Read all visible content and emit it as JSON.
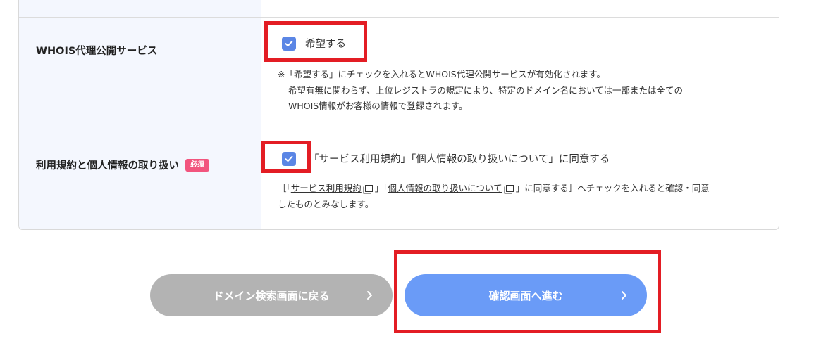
{
  "whois": {
    "label": "WHOIS代理公開サービス",
    "checkbox_label": "希望する",
    "checked": true,
    "note_line1": "※「希望する」にチェックを入れるとWHOIS代理公開サービスが有効化されます。",
    "note_line2": "希望有無に関わらず、上位レジストラの規定により、特定のドメイン名においては一部または全ての",
    "note_line3": "WHOIS情報がお客様の情報で登録されます。"
  },
  "terms": {
    "label": "利用規約と個人情報の取り扱い",
    "required_badge": "必須",
    "checkbox_label": "「サービス利用規約」「個人情報の取り扱いについて」に同意する",
    "checked": true,
    "note_prefix": "［「",
    "link1": "サービス利用規約",
    "note_mid": "」「",
    "link2": "個人情報の取り扱いについて",
    "note_suffix": "」に同意する］へチェックを入れると確認・同意",
    "note_line2": "したものとみなします。"
  },
  "buttons": {
    "back_label": "ドメイン検索画面に戻る",
    "next_label": "確認画面へ進む"
  },
  "icons": {
    "checkbox": "check-icon",
    "external_link": "external-link-icon",
    "chevron": "chevron-right-icon"
  },
  "colors": {
    "checkbox": "#5b86e5",
    "required_badge": "#f2557e",
    "next_button": "#6a9bf7",
    "back_button": "#b3b3b3",
    "highlight": "#e31d24",
    "label_bg": "#f4f7fe"
  }
}
